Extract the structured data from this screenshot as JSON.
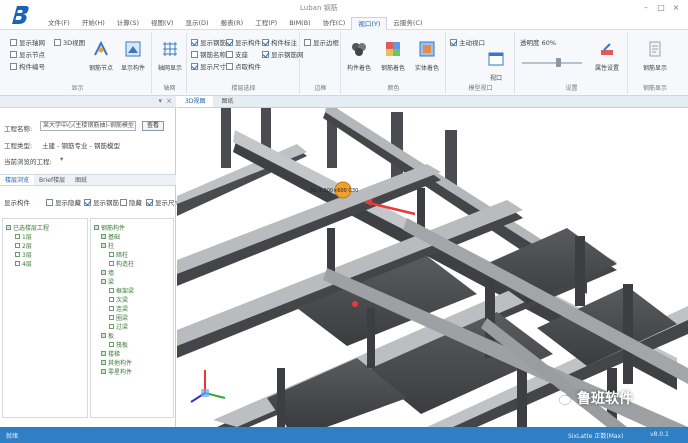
{
  "window": {
    "title": "Luban 钢筋",
    "controls": [
      "–",
      "□",
      "×"
    ]
  },
  "tabs": [
    "文件(F)",
    "开始(H)",
    "计算(S)",
    "视图(V)",
    "显示(D)",
    "报表(R)",
    "工程(P)",
    "BIM(B)",
    "协作(C)",
    "视口(Y)",
    "云服务(C)"
  ],
  "active_tab_index": 9,
  "ribbon": {
    "groups": [
      {
        "label": "显示",
        "checks": [
          {
            "label": "显示轴网",
            "on": false
          },
          {
            "label": "3D视图",
            "on": false
          },
          {
            "label": "显示节点",
            "on": false
          },
          {
            "label": "构件编号",
            "on": false
          }
        ],
        "buttons": [
          "钢筋节点",
          "显示构件"
        ]
      },
      {
        "label": "轴网",
        "buttons": [
          "轴网显示"
        ]
      },
      {
        "label": "楼层选择",
        "checks": [
          {
            "label": "显示钢筋",
            "on": true
          },
          {
            "label": "显示构件",
            "on": true
          },
          {
            "label": "构件标注",
            "on": true
          },
          {
            "label": "钢筋名称",
            "on": false
          },
          {
            "label": "支座",
            "on": false
          },
          {
            "label": "显示钢筋网",
            "on": true
          },
          {
            "label": "显示尺寸",
            "on": true
          },
          {
            "label": "点取构件",
            "on": false
          }
        ]
      },
      {
        "label": "边框",
        "checks": [
          {
            "label": "显示边框",
            "on": false
          }
        ]
      },
      {
        "label": "颜色",
        "buttons": [
          "构件着色",
          "钢筋着色",
          "实体着色"
        ]
      },
      {
        "label": "模型视口",
        "checks": [
          {
            "label": "主动视口",
            "on": true
          }
        ],
        "buttons": [
          "视口"
        ]
      },
      {
        "label": "设置",
        "slider_label": "透明度 60%",
        "slider_value": 0.6,
        "buttons": [
          "属性设置"
        ]
      },
      {
        "label": "钢筋显示",
        "buttons": [
          "钢筋显示"
        ]
      }
    ]
  },
  "left_panel": {
    "project_label": "工程名称:",
    "project_value": "某大学中心(主楼钢筋抽)-钢筋模型",
    "browse_button": "查看",
    "type_label": "工程类型:",
    "type_value": "土建 - 钢筋专业 - 钢筋模型",
    "open_label": "当前浏览的工程:",
    "subtabs": [
      "楼层浏览",
      "Brief楼层",
      "图纸"
    ],
    "filter_label": "显示构件",
    "filter_checks": [
      {
        "label": "显示隐藏",
        "on": false
      },
      {
        "label": "显示钢筋",
        "on": true
      },
      {
        "label": "隐藏",
        "on": false
      },
      {
        "label": "显示尺寸",
        "on": true
      }
    ],
    "tree_left": [
      "已选楼层工程",
      "1层",
      "2层",
      "3层",
      "4层"
    ],
    "tree_right": [
      "钢筋构件",
      "基础",
      "柱",
      "暗柱",
      "构造柱",
      "墙",
      "梁",
      "框架梁",
      "次梁",
      "连梁",
      "圈梁",
      "过梁",
      "板",
      "筏板",
      "楼梯",
      "其他构件",
      "零星构件"
    ]
  },
  "viewport": {
    "tabs": [
      "3D视图",
      "图纸"
    ],
    "callout": "KL-1 300×600 C30",
    "accent": "#e83a3a"
  },
  "status": {
    "left": "就绪",
    "right1": "SixLatte 正数(Max)",
    "right2": "v8.0.1"
  },
  "watermark": "鲁班软件",
  "colors": {
    "statusbar": "#2f7fc4",
    "ribbon": "#f6f8fb",
    "structure": "#4a4a4c",
    "beam_top": "#b9bcbf",
    "highlight": "#f0a030"
  }
}
